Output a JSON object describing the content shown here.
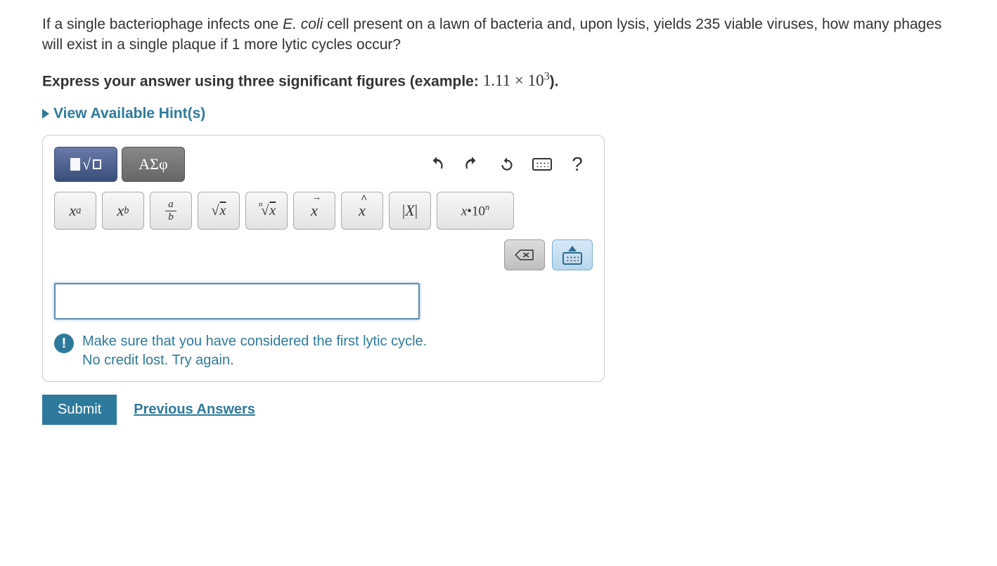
{
  "question": {
    "prefix": "If a single bacteriophage infects one ",
    "italic": "E. coli",
    "suffix": " cell present on a lawn of bacteria and, upon lysis, yields 235 viable viruses, how many phages will exist in a single plaque if 1 more lytic cycles occur?"
  },
  "instruction": {
    "text": "Express your answer using three significant figures (example: ",
    "example_base": "1.11 × 10",
    "example_exp": "3",
    "close": ")."
  },
  "hints_label": "View Available Hint(s)",
  "tabs": {
    "greek": "ΑΣφ"
  },
  "tools": {
    "help": "?"
  },
  "math_buttons": {
    "abs_open": "|",
    "abs_x": "X",
    "abs_close": "|",
    "sci_x": "x",
    "sci_dot": "•",
    "sci_base": "10",
    "sci_exp": "n",
    "frac_num": "a",
    "frac_den": "b",
    "sup_x": "x",
    "sup_a": "a",
    "sub_x": "x",
    "sub_b": "b",
    "sqrt_x": "x",
    "nroot_n": "n",
    "nroot_x": "x",
    "vec_x": "x",
    "hat_x": "x"
  },
  "answer_value": "",
  "feedback": {
    "icon": "!",
    "line1": "Make sure that you have considered the first lytic cycle.",
    "line2": "No credit lost. Try again."
  },
  "buttons": {
    "submit": "Submit",
    "previous": "Previous Answers"
  }
}
